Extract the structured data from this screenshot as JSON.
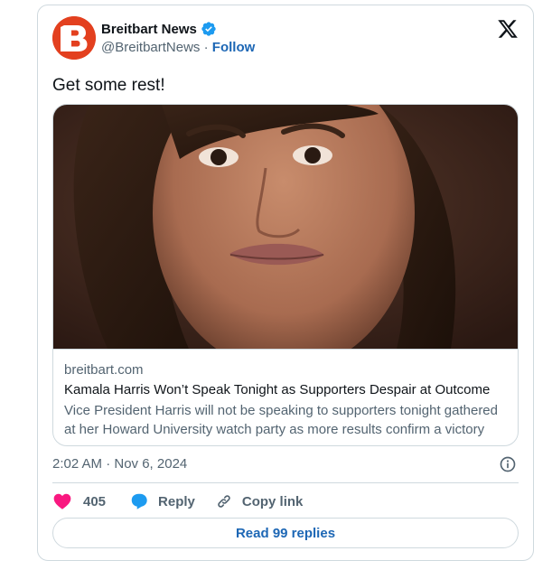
{
  "author": {
    "name": "Breitbart News",
    "handle": "@BreitbartNews",
    "separator": " · ",
    "follow_label": "Follow",
    "verified_color": "#1d9bf0",
    "avatar_color": "#e3401f",
    "avatar_icon": "breitbart-b-logo"
  },
  "brand_icon": "x-logo-icon",
  "tweet_text": "Get some rest!",
  "link_card": {
    "image_icon": "woman-portrait-photo",
    "domain": "breitbart.com",
    "title": "Kamala Harris Won’t Speak Tonight as Supporters Despair at Outcome",
    "description": "Vice President Harris will not be speaking to supporters tonight gathered at her Howard University watch party as more results confirm a victory b..."
  },
  "timestamp": "2:02 AM · Nov 6, 2024",
  "actions": {
    "like_count": "405",
    "like_color": "#f91880",
    "reply_label": "Reply",
    "reply_color": "#1d9bf0",
    "copy_label": "Copy link"
  },
  "read_replies_label": "Read 99 replies",
  "accent_color": "#1d67b5"
}
